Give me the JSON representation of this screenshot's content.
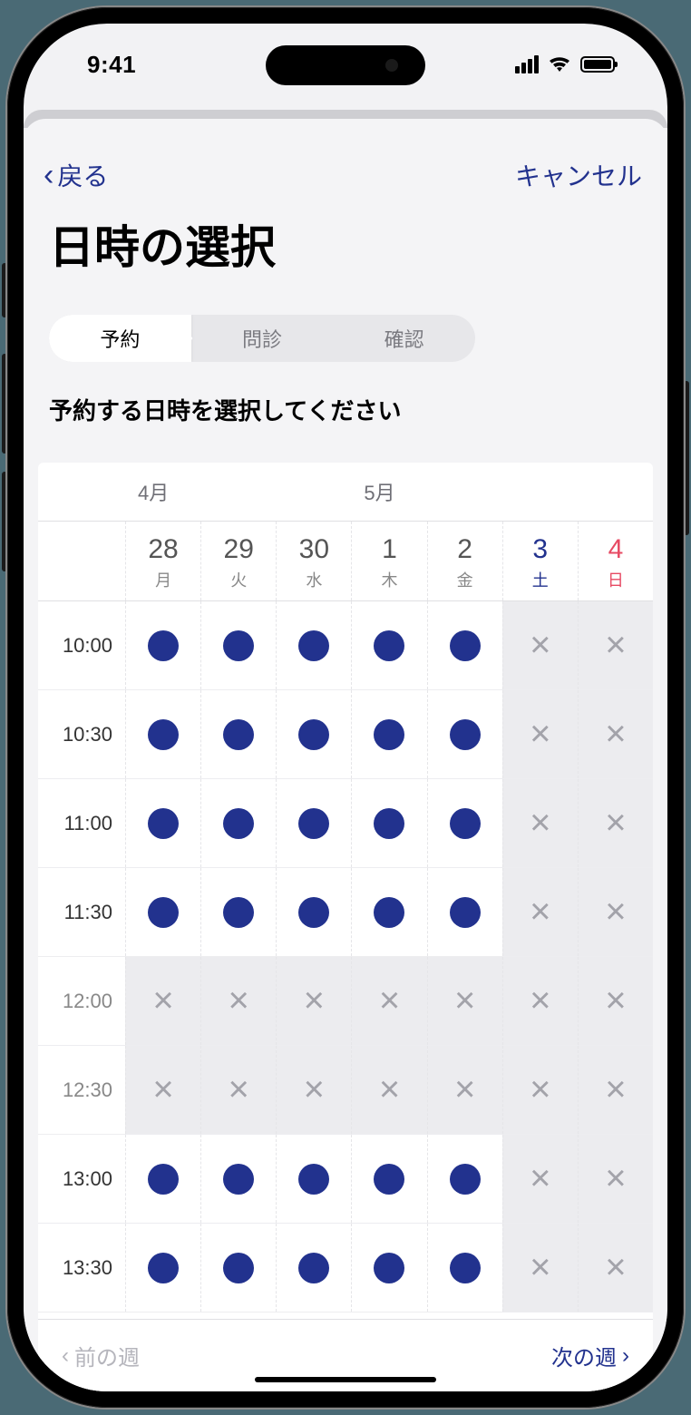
{
  "status": {
    "time": "9:41"
  },
  "nav": {
    "back_label": "戻る",
    "cancel_label": "キャンセル"
  },
  "title": "日時の選択",
  "steps": [
    {
      "label": "予約",
      "active": true
    },
    {
      "label": "問診",
      "active": false
    },
    {
      "label": "確認",
      "active": false
    }
  ],
  "subtitle": "予約する日時を選択してください",
  "calendar": {
    "months": [
      {
        "label": "4月",
        "span": 3
      },
      {
        "label": "5月",
        "span": 4
      }
    ],
    "days": [
      {
        "num": "28",
        "wd": "月",
        "class": ""
      },
      {
        "num": "29",
        "wd": "火",
        "class": ""
      },
      {
        "num": "30",
        "wd": "水",
        "class": ""
      },
      {
        "num": "1",
        "wd": "木",
        "class": ""
      },
      {
        "num": "2",
        "wd": "金",
        "class": ""
      },
      {
        "num": "3",
        "wd": "土",
        "class": "sat"
      },
      {
        "num": "4",
        "wd": "日",
        "class": "sun"
      }
    ],
    "times": [
      {
        "label": "10:00",
        "cells": [
          "o",
          "o",
          "o",
          "o",
          "o",
          "x",
          "x"
        ]
      },
      {
        "label": "10:30",
        "cells": [
          "o",
          "o",
          "o",
          "o",
          "o",
          "x",
          "x"
        ]
      },
      {
        "label": "11:00",
        "cells": [
          "o",
          "o",
          "o",
          "o",
          "o",
          "x",
          "x"
        ]
      },
      {
        "label": "11:30",
        "cells": [
          "o",
          "o",
          "o",
          "o",
          "o",
          "x",
          "x"
        ]
      },
      {
        "label": "12:00",
        "cells": [
          "x",
          "x",
          "x",
          "x",
          "x",
          "x",
          "x"
        ]
      },
      {
        "label": "12:30",
        "cells": [
          "x",
          "x",
          "x",
          "x",
          "x",
          "x",
          "x"
        ]
      },
      {
        "label": "13:00",
        "cells": [
          "o",
          "o",
          "o",
          "o",
          "o",
          "x",
          "x"
        ]
      },
      {
        "label": "13:30",
        "cells": [
          "o",
          "o",
          "o",
          "o",
          "o",
          "x",
          "x"
        ]
      }
    ],
    "prev_week": "前の週",
    "next_week": "次の週",
    "prev_enabled": false,
    "next_enabled": true
  }
}
